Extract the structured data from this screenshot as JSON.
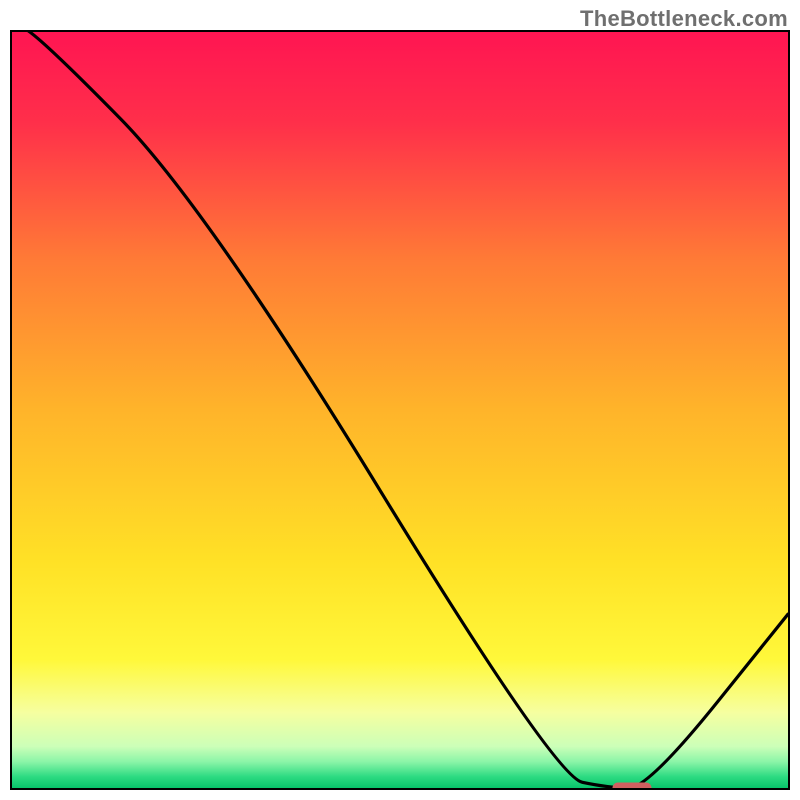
{
  "watermark": "TheBottleneck.com",
  "chart_data": {
    "type": "line",
    "x": [
      0.0,
      0.03,
      0.25,
      0.7,
      0.77,
      0.82,
      1.0
    ],
    "y": [
      1.01,
      1.0,
      0.77,
      0.015,
      0.0,
      0.0,
      0.23
    ],
    "title": "",
    "xlabel": "",
    "ylabel": "",
    "xlim": [
      0,
      1
    ],
    "ylim": [
      0,
      1
    ],
    "marker": {
      "x_start": 0.77,
      "x_end": 0.82,
      "y": 0.005
    },
    "gradient_stops": [
      {
        "pos": 0.0,
        "color": "#ff1552"
      },
      {
        "pos": 0.12,
        "color": "#ff2f4a"
      },
      {
        "pos": 0.3,
        "color": "#ff7a36"
      },
      {
        "pos": 0.5,
        "color": "#ffb42a"
      },
      {
        "pos": 0.7,
        "color": "#ffe126"
      },
      {
        "pos": 0.83,
        "color": "#fff83a"
      },
      {
        "pos": 0.9,
        "color": "#f6ffa0"
      },
      {
        "pos": 0.945,
        "color": "#ccffb8"
      },
      {
        "pos": 0.965,
        "color": "#8cf5a8"
      },
      {
        "pos": 0.985,
        "color": "#2ddb82"
      },
      {
        "pos": 1.0,
        "color": "#08c46b"
      }
    ]
  }
}
